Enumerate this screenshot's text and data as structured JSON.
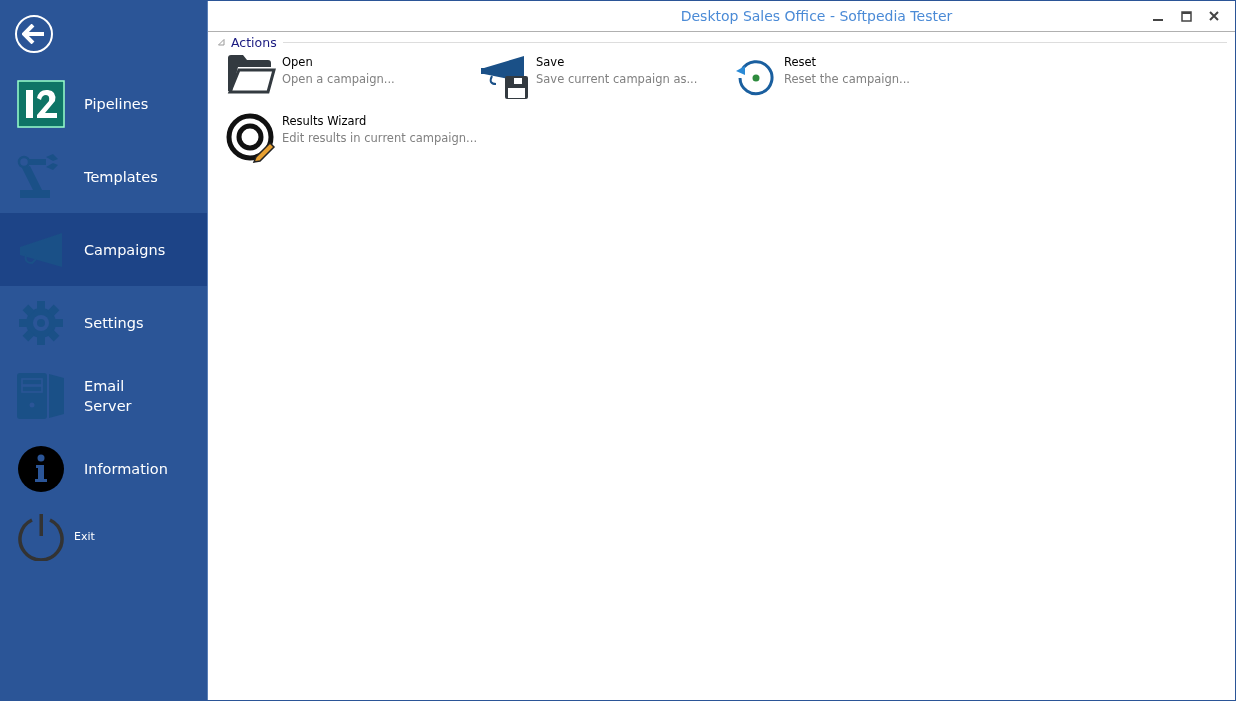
{
  "window": {
    "title": "Desktop Sales Office - Softpedia Tester"
  },
  "sidebar": {
    "items": [
      {
        "kind": "pipelines",
        "label": "Pipelines",
        "selected": false
      },
      {
        "kind": "templates",
        "label": "Templates",
        "selected": false
      },
      {
        "kind": "campaigns",
        "label": "Campaigns",
        "selected": true
      },
      {
        "kind": "settings",
        "label": "Settings",
        "selected": false
      },
      {
        "kind": "server",
        "label": "Email\nServer",
        "selected": false
      },
      {
        "kind": "information",
        "label": "Information",
        "selected": false
      },
      {
        "kind": "exit",
        "label": "Exit",
        "selected": false
      }
    ]
  },
  "actions": {
    "title": "Actions",
    "expanded": true,
    "items": [
      {
        "kind": "open",
        "title": "Open",
        "description": "Open a campaign..."
      },
      {
        "kind": "save",
        "title": "Save",
        "description": "Save current campaign as..."
      },
      {
        "kind": "reset",
        "title": "Reset",
        "description": "Reset the campaign..."
      },
      {
        "kind": "wizard",
        "title": "Results Wizard",
        "description": "Edit results in current campaign..."
      }
    ]
  }
}
